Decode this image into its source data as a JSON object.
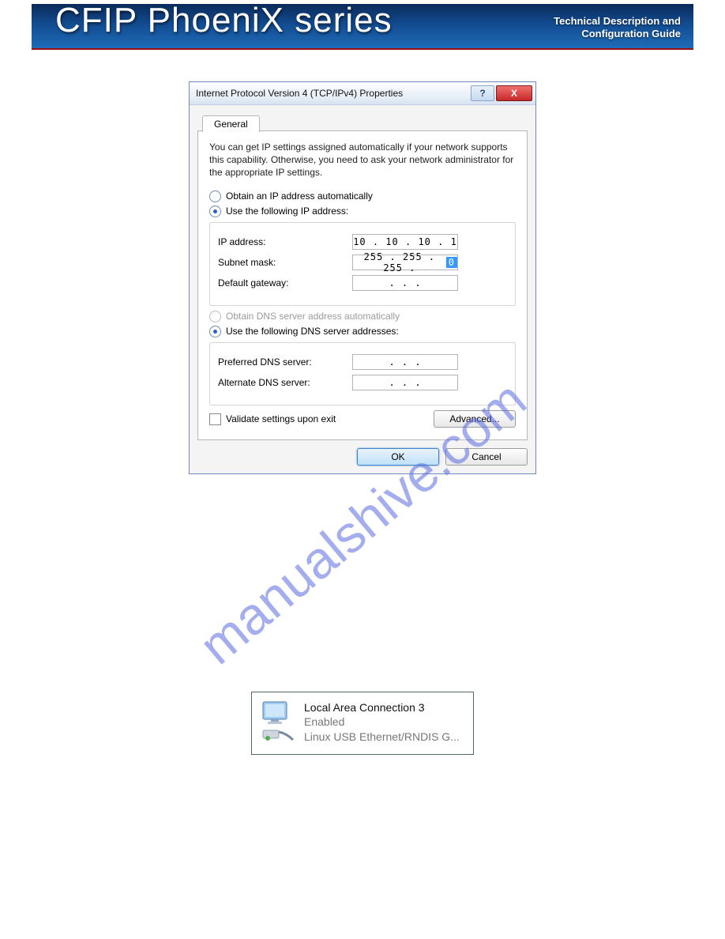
{
  "banner": {
    "title": "CFIP PhoeniX series",
    "subtitle_line1": "Technical Description and",
    "subtitle_line2": "Configuration Guide"
  },
  "watermark": "manualshive.com",
  "dialog": {
    "title": "Internet Protocol Version 4 (TCP/IPv4) Properties",
    "tab": "General",
    "description": "You can get IP settings assigned automatically if your network supports this capability. Otherwise, you need to ask your network administrator for the appropriate IP settings.",
    "ip_group": {
      "option_auto": "Obtain an IP address automatically",
      "option_static": "Use the following IP address:",
      "selected": "static",
      "fields": {
        "ip_label": "IP address:",
        "ip_value": "10 . 10 . 10 .  1",
        "subnet_label": "Subnet mask:",
        "subnet_value_prefix": "255 . 255 . 255 . ",
        "subnet_value_selected": "0",
        "gateway_label": "Default gateway:",
        "gateway_value": ".       .       ."
      }
    },
    "dns_group": {
      "option_auto": "Obtain DNS server address automatically",
      "option_auto_enabled": false,
      "option_static": "Use the following DNS server addresses:",
      "selected": "static",
      "fields": {
        "preferred_label": "Preferred DNS server:",
        "preferred_value": ".       .       .",
        "alternate_label": "Alternate DNS server:",
        "alternate_value": ".       .       ."
      }
    },
    "validate_label": "Validate settings upon exit",
    "validate_checked": false,
    "advanced_label": "Advanced...",
    "ok_label": "OK",
    "cancel_label": "Cancel",
    "help_glyph": "?",
    "close_glyph": "X"
  },
  "netcard": {
    "title": "Local Area Connection 3",
    "status": "Enabled",
    "device": "Linux USB Ethernet/RNDIS G..."
  }
}
